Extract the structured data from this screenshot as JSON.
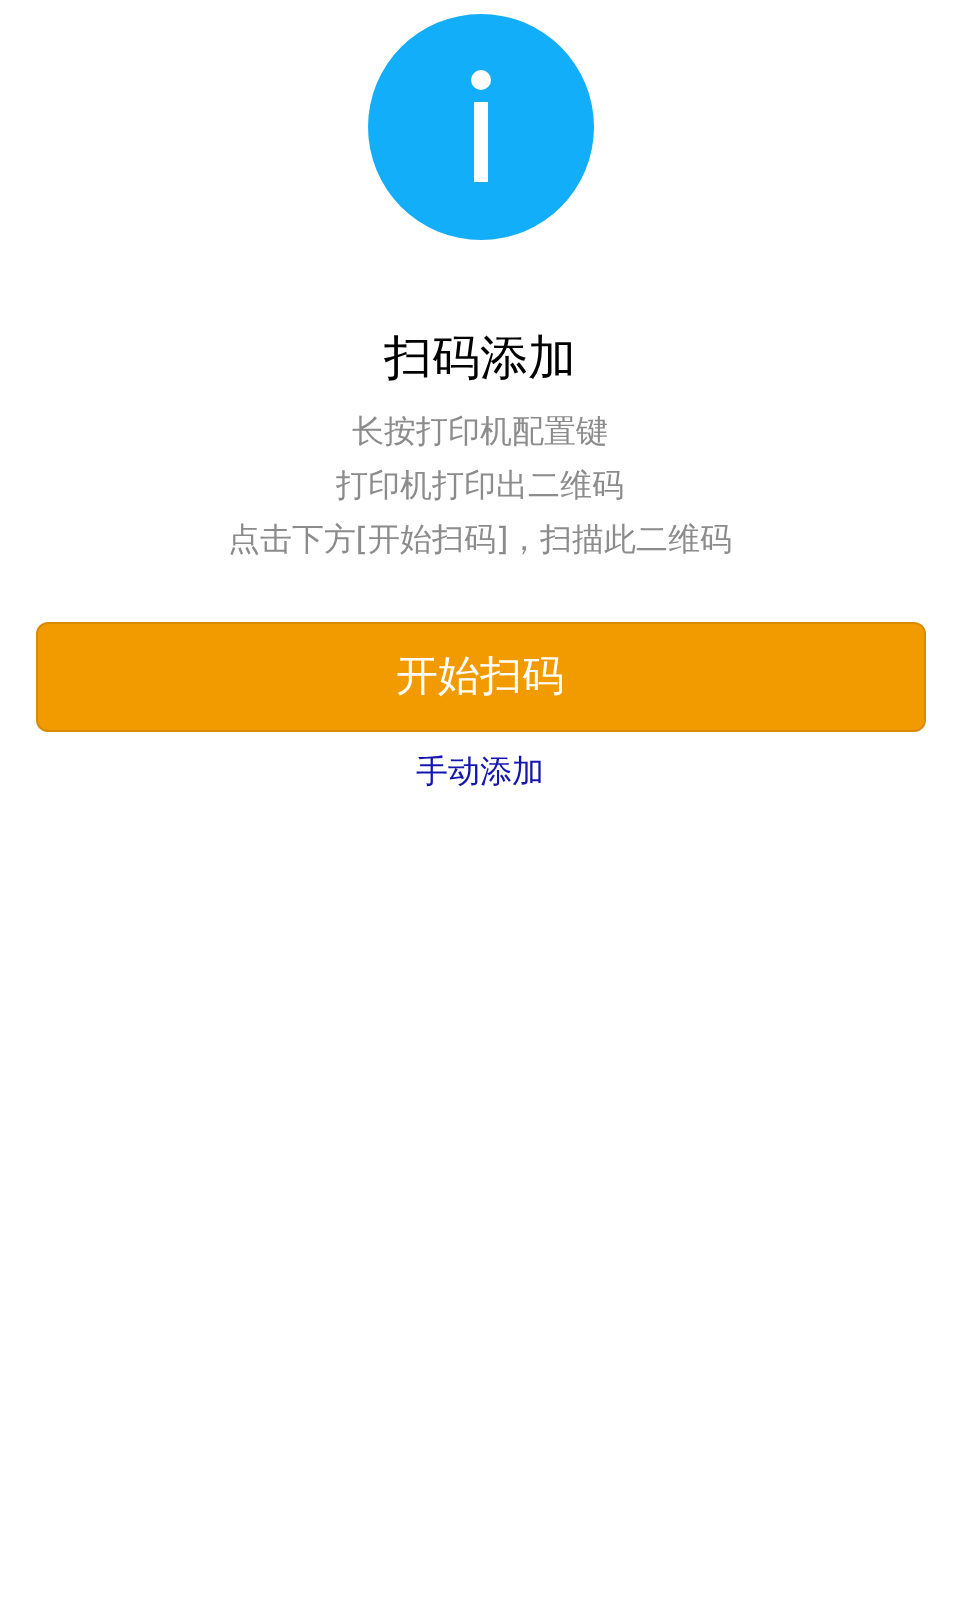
{
  "title": "扫码添加",
  "instructions": [
    "长按打印机配置键",
    "打印机打印出二维码",
    "点击下方[开始扫码]，扫描此二维码"
  ],
  "primary_button": {
    "label": "开始扫码"
  },
  "link": {
    "label": "手动添加"
  }
}
